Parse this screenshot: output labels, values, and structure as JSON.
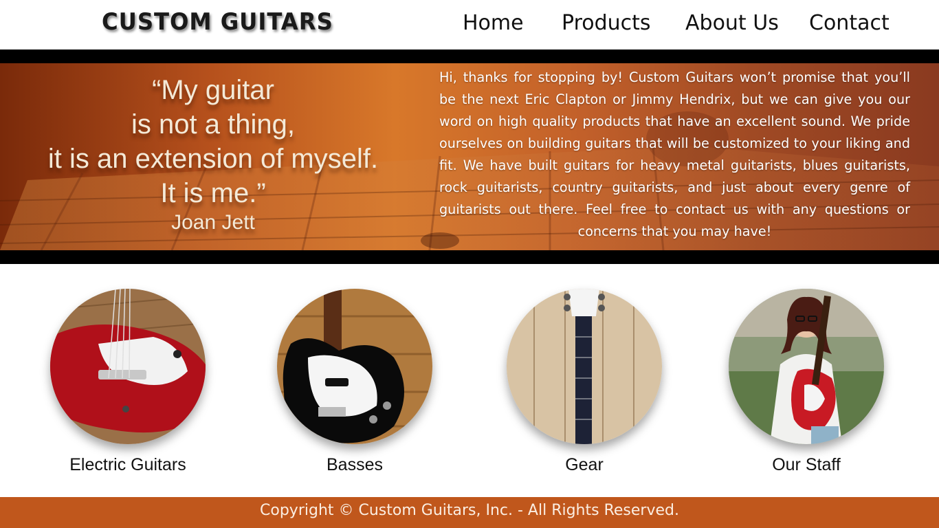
{
  "brand": {
    "logo_text": "CUSTOM GUITARS"
  },
  "nav": {
    "home": "Home",
    "products": "Products",
    "about": "About Us",
    "contact": "Contact"
  },
  "hero": {
    "quote_lines": [
      "“My guitar",
      "is not a thing,",
      "it is an extension of myself.",
      "It is me.”"
    ],
    "quote_author": "Joan Jett",
    "intro": "Hi, thanks for stopping by! Custom Guitars won’t promise that you’ll be the next Eric Clapton or Jimmy Hendrix, but we can give you our word on high quality products that have an excellent sound. We pride ourselves on building guitars that will be customized to your liking and fit. We have built guitars for heavy metal guitarists, blues guitarists, rock guitarists, country guitarists, and just about every genre of guitarists out there. Feel free to contact us with any questions or concerns that you may have!"
  },
  "products": [
    {
      "label": "Electric Guitars",
      "image": "red-electric-guitar-photo"
    },
    {
      "label": "Basses",
      "image": "black-bass-guitar-photo"
    },
    {
      "label": "Gear",
      "image": "white-guitar-neck-on-wood-photo"
    },
    {
      "label": "Our Staff",
      "image": "staff-member-with-red-bass-photo"
    }
  ],
  "footer": {
    "copyright": "Copyright © Custom Guitars, Inc. - All Rights Reserved."
  },
  "colors": {
    "accent": "#c0571c",
    "hero_bar": "#000000",
    "text": "#111111"
  }
}
